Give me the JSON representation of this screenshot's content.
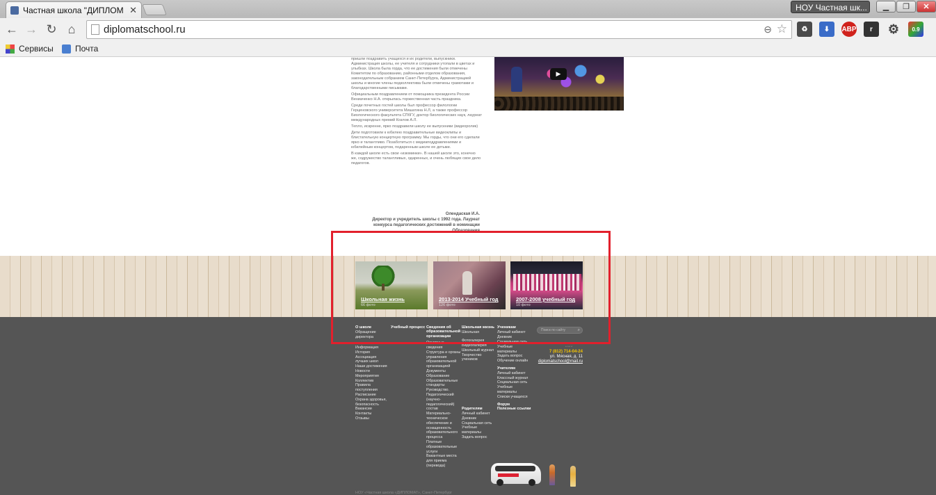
{
  "browser": {
    "tab_title": "Частная школа \"ДИПЛОМ",
    "profile_name": "НОУ Частная шк...",
    "url": "diplomatschool.ru",
    "ext_abp": "ABP",
    "ext_badge": "0.9",
    "bookmarks": [
      {
        "label": "Сервисы",
        "icon": "apps-icon"
      },
      {
        "label": "Почта",
        "icon": "mail-icon"
      }
    ]
  },
  "article": {
    "paragraphs": [
      "пришли поздравить учащихся и их родители, выпускники. Администрация школы, ее учителя и сотрудники утопали в цветах и улыбках. Школа была горда, что ее достижения были отмечены Комитетом по образованию, районными отделом образования, законодательным собранием Санкт-Петербурга, Администрацией школы и многие члены педколлектива были отмечены грамотами и благодарственными письмами.",
      "Официальным поздравлением от помощника президента России Вениаченко Н.А. открылась торжественная часть праздника.",
      "Среди почетных гостей школы был профессор филологии Герценовского университета Мишатина Н.Л, а также профессор Биологического факультета СПбГУ, доктор биологических наук, лауреат международных премий Козлов А.Л.",
      " Тепло, искренне, ярко поздравили школу ее выпускники (видеоролик)",
      "Дети подготовили к юбилею поздравительные видеоклипы и блистательную концертную программу. Мы горды, что они его сделали ярко и талантливо. Позаботиться с медиаподдравлениями и юбилейным концертом, подаренным школе ее детьми.",
      "В каждой школе есть свои «изюминки». В нашей школе это, конечно же, содружество талантливых, одаренных, и очень любящих свое дело педагогов."
    ],
    "signature": [
      "Олендаская И.А.",
      "Директор и учредитель школы с 1992 года. Лауреат конкурса педагогических достижений в номинации",
      "Образования"
    ]
  },
  "galleries": [
    {
      "title": "Школьная жизнь",
      "count": "66 фото"
    },
    {
      "title": "2013-2014 Учебный год",
      "count": "126 фото"
    },
    {
      "title": "2007-2008 учебный год",
      "count": "10 фото"
    }
  ],
  "footer": {
    "columns": [
      {
        "heading": "О школе",
        "items": [
          "Обращение директора",
          "Информация",
          "История",
          "Ассоциация лучших школ",
          "Наши достижения",
          "Новости",
          "Мероприятия",
          "Коллектив",
          "Правила поступления",
          "Расписание",
          "Охрана здоровья, безопасность",
          "Вакансии",
          "Контакты",
          "Отзывы"
        ]
      },
      {
        "heading": "Учебный процесс",
        "items": []
      },
      {
        "heading": "Сведения об образовательной организации",
        "items": [
          "Основные сведения",
          "Структура и органы управления образовательной организацией",
          "Документы",
          "Образование",
          "Образовательные стандарты",
          "Руководство. Педагогический (научно-педагогический) состав",
          "Материально-техническое обеспечение и оснащенность образовательного процесса",
          "Платные образовательные услуги",
          "Вакантные места для приема (перевода)"
        ]
      },
      {
        "heading": "Школьная жизнь",
        "items": [
          "Школьная",
          "Фотогалерея",
          "Видеогалерея",
          "Школьный журнал",
          "Творчество учеников"
        ],
        "subsections": [
          {
            "heading": "Родителям",
            "items": [
              "Личный кабинет",
              "Дневник",
              "Социальная сеть",
              "Учебные материалы",
              "Задать вопрос"
            ]
          }
        ]
      },
      {
        "heading": "Ученикам",
        "items": [
          "Личный кабинет",
          "Дневник",
          "Социальная сеть",
          "Учебные материалы",
          "Задать вопрос",
          "Обучение онлайн"
        ],
        "subsections": [
          {
            "heading": "Учителям",
            "items": [
              "Личный кабинет",
              "Классный журнал",
              "Социальная сеть",
              "Учебные материалы",
              "Списки учащихся"
            ]
          },
          {
            "heading": "Форум",
            "items": []
          },
          {
            "heading": "Полезные ссылки",
            "items": []
          }
        ]
      }
    ],
    "search_placeholder": "Поиск по сайту",
    "phone": "7 (812) 714-04-24",
    "address": "ул. Мясная, д. 11",
    "email": "diplomatschool@mail.ru",
    "copyright": "НОУ «Частная школа «ДИПЛОМАТ», Санкт-Петербург"
  },
  "colors": {
    "highlight": "#e2202c",
    "footer_bg": "#555555",
    "phone": "#f5c400"
  }
}
